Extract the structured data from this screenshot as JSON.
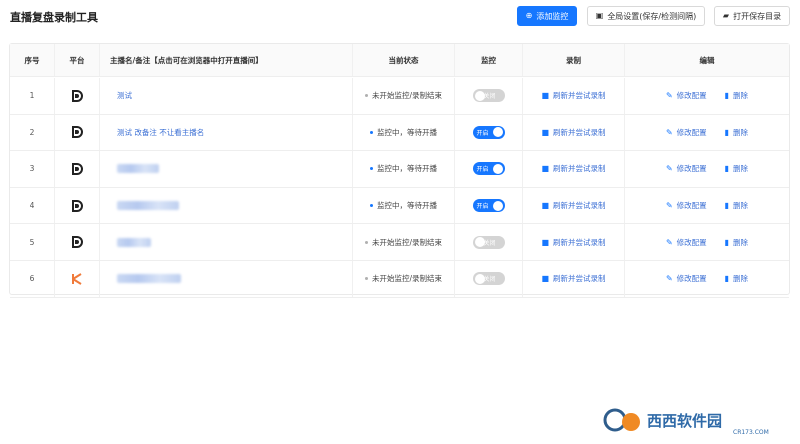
{
  "app": {
    "title": "直播复盘录制工具"
  },
  "toolbar": {
    "add_monitor": "添加监控",
    "global_settings": "全局设置(保存/检测间隔)",
    "open_dir": "打开保存目录"
  },
  "table": {
    "headers": {
      "index": "序号",
      "platform": "平台",
      "name": "主播名/备注【点击可在浏览器中打开直播间】",
      "status": "当前状态",
      "monitor": "监控",
      "record": "录制",
      "edit": "编辑"
    },
    "rows": [
      {
        "index": "1",
        "platform": "douyin",
        "name": "测试",
        "status": "未开始监控/录制结束",
        "status_color": "#b0b0b0",
        "monitor": "关闭",
        "monitor_on": false,
        "record": "刷新并尝试录制",
        "edit": "修改配置",
        "delete": "删除"
      },
      {
        "index": "2",
        "platform": "douyin",
        "name": "测试 改备注 不让看主播名",
        "status": "监控中，等待开播",
        "status_color": "#1677ff",
        "monitor": "开启",
        "monitor_on": true,
        "record": "刷新并尝试录制",
        "edit": "修改配置",
        "delete": "删除"
      },
      {
        "index": "3",
        "platform": "douyin",
        "name": "",
        "status": "监控中，等待开播",
        "status_color": "#1677ff",
        "monitor": "开启",
        "monitor_on": true,
        "record": "刷新并尝试录制",
        "edit": "修改配置",
        "delete": "删除"
      },
      {
        "index": "4",
        "platform": "douyin",
        "name": "",
        "status": "监控中，等待开播",
        "status_color": "#1677ff",
        "monitor": "开启",
        "monitor_on": true,
        "record": "刷新并尝试录制",
        "edit": "修改配置",
        "delete": "删除"
      },
      {
        "index": "5",
        "platform": "douyin",
        "name": "",
        "status": "未开始监控/录制结束",
        "status_color": "#b0b0b0",
        "monitor": "关闭",
        "monitor_on": false,
        "record": "刷新并尝试录制",
        "edit": "修改配置",
        "delete": "删除"
      },
      {
        "index": "6",
        "platform": "kuaishou",
        "name": "",
        "status": "未开始监控/录制结束",
        "status_color": "#b0b0b0",
        "monitor": "关闭",
        "monitor_on": false,
        "record": "刷新并尝试录制",
        "edit": "修改配置",
        "delete": "删除"
      }
    ]
  },
  "icons": {
    "add": "plus-circle-icon",
    "settings": "settings-icon",
    "folder": "folder-open-icon",
    "record": "video-camera-icon",
    "edit": "pencil-icon",
    "delete": "trash-icon",
    "douyin": "douyin-logo-icon",
    "kuaishou": "kuaishou-logo-icon"
  },
  "colors": {
    "accent": "#1677ff",
    "link": "#3b6fd4",
    "muted": "#b0b0b0"
  },
  "watermark": {
    "text": "西西软件园",
    "sub": "CR173.COM"
  }
}
